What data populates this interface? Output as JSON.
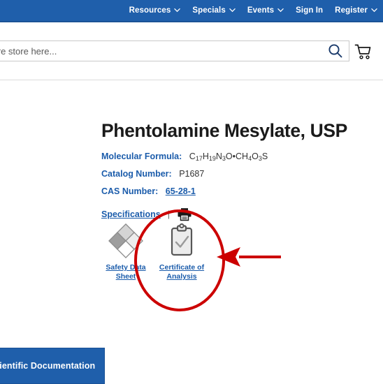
{
  "topnav": {
    "background_color": "#1f5fab",
    "items": [
      {
        "label": "Resources",
        "has_caret": true
      },
      {
        "label": "Specials",
        "has_caret": true
      },
      {
        "label": "Events",
        "has_caret": true
      },
      {
        "label": "Sign In",
        "has_caret": false
      },
      {
        "label": "Register",
        "has_caret": true
      }
    ]
  },
  "search": {
    "value": "",
    "placeholder": "Search entire store here...",
    "search_icon": "search-icon",
    "cart_icon": "shopping-cart-icon"
  },
  "product": {
    "title": "Phentolamine Mesylate, USP",
    "molecular_formula_label": "Molecular Formula:",
    "molecular_formula_value": "C17H19N3O•CH4O3S",
    "catalog_number_label": "Catalog Number:",
    "catalog_number_value": "P1687",
    "cas_number_label": "CAS Number:",
    "cas_number_value": "65-28-1",
    "specifications_link": "Specifications",
    "separator": "|",
    "print_icon": "printer-icon"
  },
  "documents": [
    {
      "label": "Safety Data Sheet",
      "line1": "Safety Data",
      "line2": "Sheet",
      "icon": "ghs-diamond-icon"
    },
    {
      "label": "Certificate of Analysis",
      "line1": "Certificate of",
      "line2": "Analysis",
      "icon": "clipboard-check-icon"
    }
  ],
  "annotations": {
    "highlight_color": "#cc0000",
    "ellipse_target": "Certificate of Analysis",
    "arrow_direction": "left"
  },
  "footer_button": {
    "label": "Scientific Documentation",
    "background_color": "#1f5fab"
  }
}
